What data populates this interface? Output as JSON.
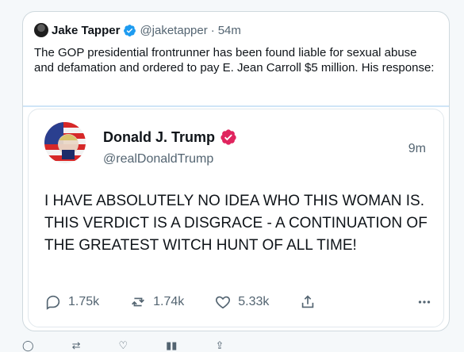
{
  "quoted_tweet": {
    "author_name": "Jake Tapper",
    "author_handle": "@jaketapper",
    "time": "54m",
    "text": "The GOP presidential frontrunner has been found liable for sexual abuse and defamation and ordered to pay E. Jean Carroll $5 million. His response:"
  },
  "inner_tweet": {
    "author_name": "Donald J. Trump",
    "author_handle": "@realDonaldTrump",
    "time": "9m",
    "text": "I HAVE ABSOLUTELY NO IDEA WHO THIS WOMAN IS. THIS VERDICT IS A DISGRACE - A CONTINUATION OF THE GREATEST WITCH HUNT OF ALL TIME!",
    "metrics": {
      "replies": "1.75k",
      "reposts": "1.74k",
      "likes": "5.33k"
    }
  },
  "colors": {
    "verified_blue": "#1d9bf0",
    "verified_pink": "#e0245e",
    "text_primary": "#0f1419",
    "text_secondary": "#536471"
  },
  "icons": [
    "verified-badge-icon",
    "reply-icon",
    "repost-icon",
    "like-icon",
    "share-icon",
    "more-icon"
  ]
}
